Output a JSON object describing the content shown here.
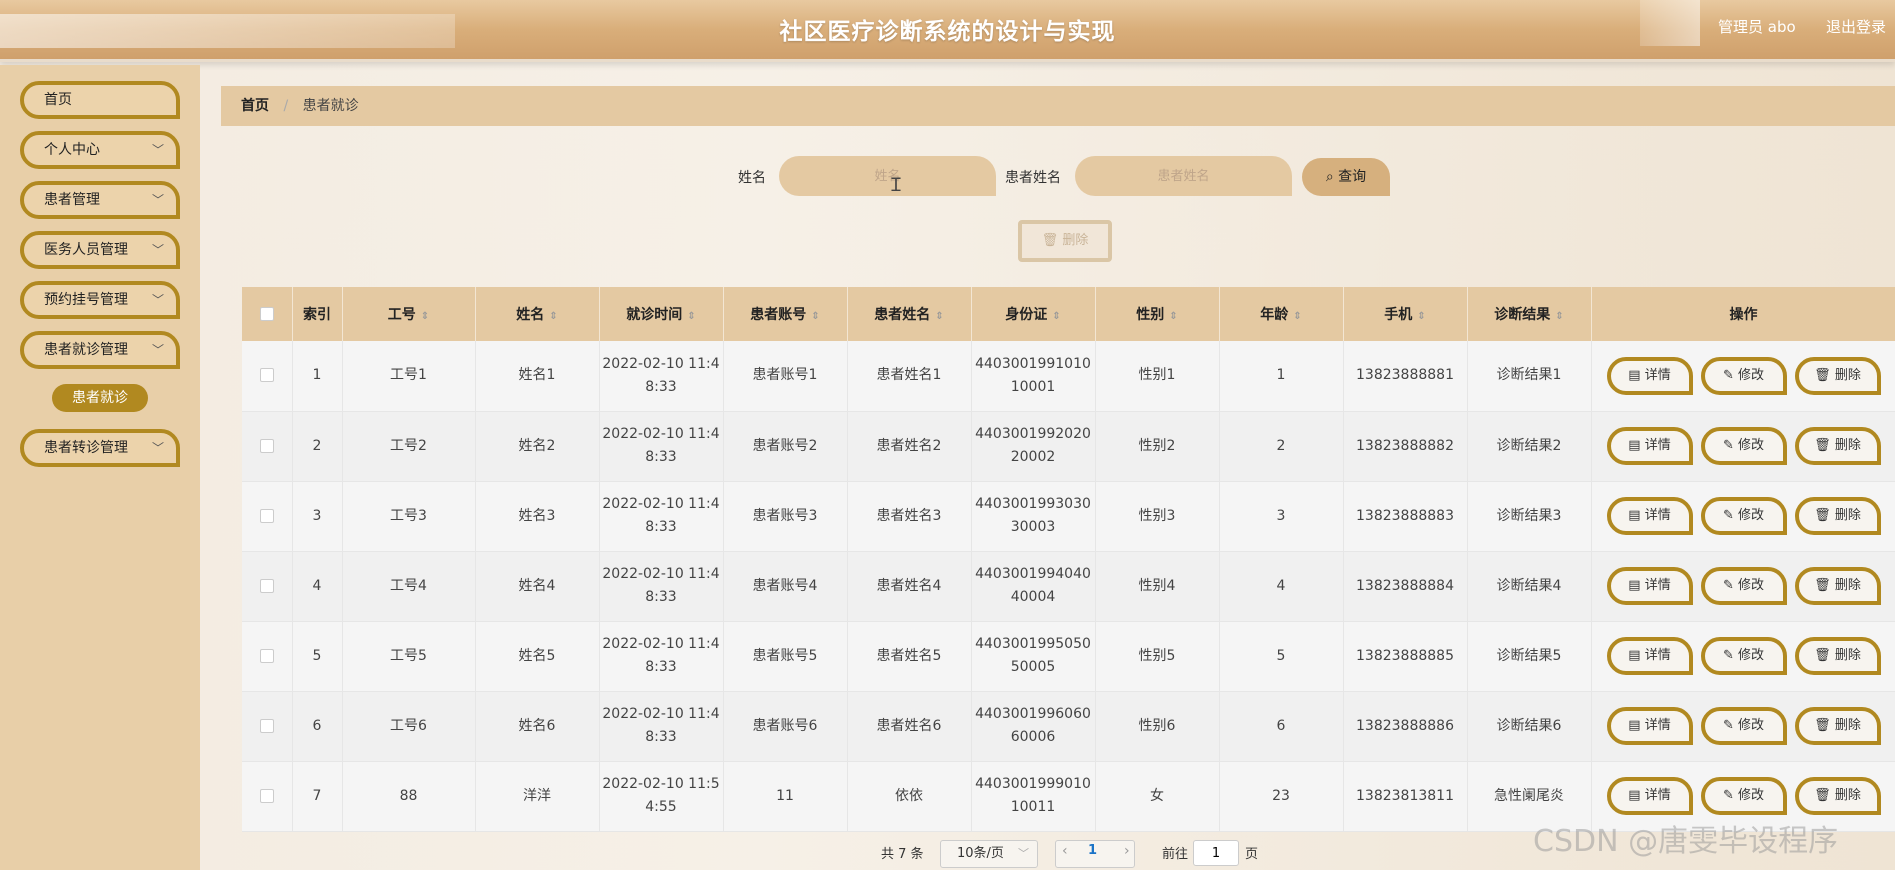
{
  "header": {
    "title": "社区医疗诊断系统的设计与实现",
    "user": "管理员 abo",
    "logout": "退出登录"
  },
  "sidebar": {
    "items": [
      {
        "label": "首页",
        "has_children": false
      },
      {
        "label": "个人中心",
        "has_children": true
      },
      {
        "label": "患者管理",
        "has_children": true
      },
      {
        "label": "医务人员管理",
        "has_children": true
      },
      {
        "label": "预约挂号管理",
        "has_children": true
      },
      {
        "label": "患者就诊管理",
        "has_children": true
      },
      {
        "label": "患者转诊管理",
        "has_children": true
      }
    ],
    "active_submenu": "患者就诊"
  },
  "breadcrumb": {
    "home": "首页",
    "separator": "/",
    "current": "患者就诊"
  },
  "search": {
    "name_label": "姓名",
    "name_placeholder": "姓名",
    "patient_label": "患者姓名",
    "patient_placeholder": "患者姓名",
    "query_button": "查询"
  },
  "batch_delete": "删除",
  "table": {
    "columns": [
      "索引",
      "工号",
      "姓名",
      "就诊时间",
      "患者账号",
      "患者姓名",
      "身份证",
      "性别",
      "年龄",
      "手机",
      "诊断结果",
      "操作"
    ],
    "rows": [
      {
        "index": "1",
        "staff_no": "工号1",
        "name": "姓名1",
        "time": "2022-02-10 11:48:33",
        "account": "患者账号1",
        "patient": "患者姓名1",
        "id_card": "440300199101010001",
        "gender": "性别1",
        "age": "1",
        "phone": "13823888881",
        "result": "诊断结果1"
      },
      {
        "index": "2",
        "staff_no": "工号2",
        "name": "姓名2",
        "time": "2022-02-10 11:48:33",
        "account": "患者账号2",
        "patient": "患者姓名2",
        "id_card": "440300199202020002",
        "gender": "性别2",
        "age": "2",
        "phone": "13823888882",
        "result": "诊断结果2"
      },
      {
        "index": "3",
        "staff_no": "工号3",
        "name": "姓名3",
        "time": "2022-02-10 11:48:33",
        "account": "患者账号3",
        "patient": "患者姓名3",
        "id_card": "440300199303030003",
        "gender": "性别3",
        "age": "3",
        "phone": "13823888883",
        "result": "诊断结果3"
      },
      {
        "index": "4",
        "staff_no": "工号4",
        "name": "姓名4",
        "time": "2022-02-10 11:48:33",
        "account": "患者账号4",
        "patient": "患者姓名4",
        "id_card": "440300199404040004",
        "gender": "性别4",
        "age": "4",
        "phone": "13823888884",
        "result": "诊断结果4"
      },
      {
        "index": "5",
        "staff_no": "工号5",
        "name": "姓名5",
        "time": "2022-02-10 11:48:33",
        "account": "患者账号5",
        "patient": "患者姓名5",
        "id_card": "440300199505050005",
        "gender": "性别5",
        "age": "5",
        "phone": "13823888885",
        "result": "诊断结果5"
      },
      {
        "index": "6",
        "staff_no": "工号6",
        "name": "姓名6",
        "time": "2022-02-10 11:48:33",
        "account": "患者账号6",
        "patient": "患者姓名6",
        "id_card": "440300199606060006",
        "gender": "性别6",
        "age": "6",
        "phone": "13823888886",
        "result": "诊断结果6"
      },
      {
        "index": "7",
        "staff_no": "88",
        "name": "洋洋",
        "time": "2022-02-10 11:54:55",
        "account": "11",
        "patient": "依依",
        "id_card": "440300199901010011",
        "gender": "女",
        "age": "23",
        "phone": "13823813811",
        "result": "急性阑尾炎"
      }
    ],
    "actions": {
      "detail": "详情",
      "edit": "修改",
      "delete": "删除"
    }
  },
  "pagination": {
    "total": "共 7 条",
    "page_size": "10条/页",
    "current_page": "1",
    "goto_label": "前往",
    "goto_value": "1",
    "page_suffix": "页"
  },
  "watermark": "CSDN @唐雯毕设程序",
  "colors": {
    "accent": "#b18920",
    "header": "#d9ae7a",
    "panel": "#e4c9a2"
  }
}
